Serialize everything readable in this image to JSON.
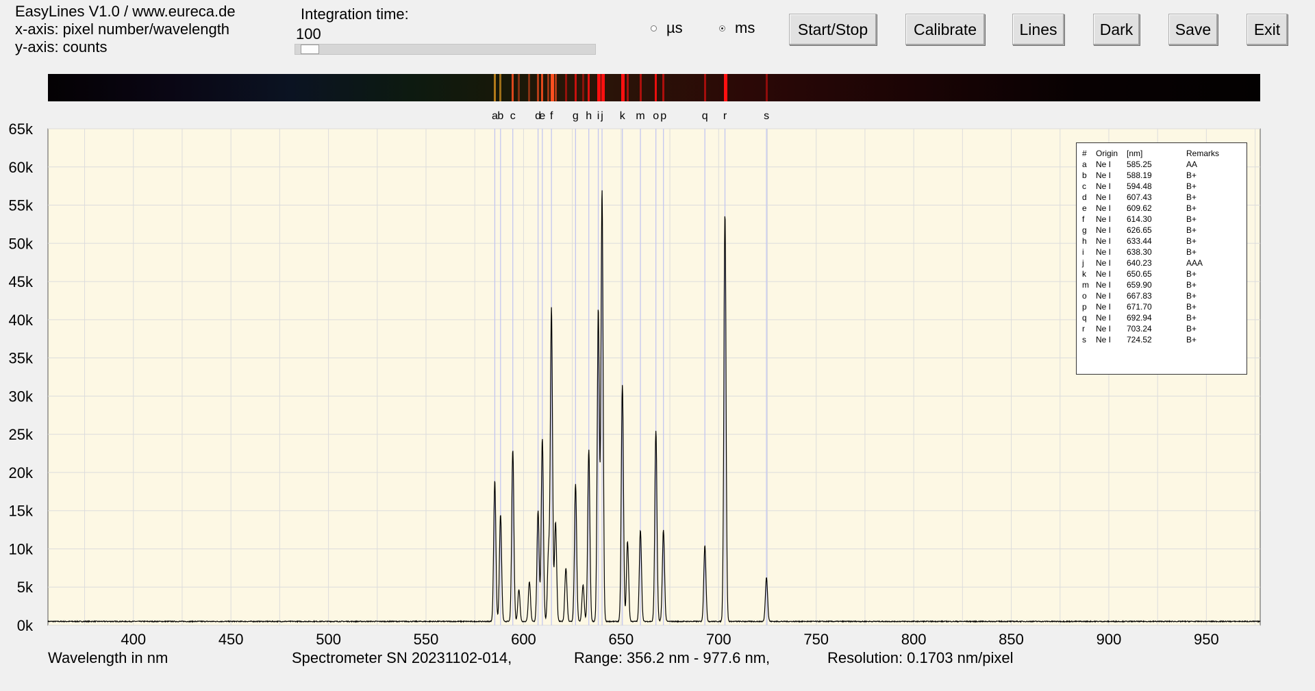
{
  "header": {
    "title": "EasyLines V1.0 / www.eureca.de",
    "xaxis_info": "x-axis: pixel number/wavelength",
    "yaxis_info": "y-axis: counts"
  },
  "integration": {
    "label": "Integration time:",
    "value": "100",
    "slider_fraction": 0.01
  },
  "units": {
    "us_label": "µs",
    "ms_label": "ms",
    "selected": "ms"
  },
  "buttons": {
    "start_stop": "Start/Stop",
    "calibrate": "Calibrate",
    "lines": "Lines",
    "dark": "Dark",
    "save": "Save",
    "exit": "Exit"
  },
  "footer": {
    "xlabel": "Wavelength in nm",
    "serial": "Spectrometer SN 20231102-014,",
    "range": "Range: 356.2 nm - 977.6 nm,",
    "resolution": "Resolution: 0.1703 nm/pixel"
  },
  "colors": {
    "plot_background": "#fdf8e4",
    "grid": "#dcdcdc",
    "line_marker": "#c3c6f0",
    "trace": "#000000"
  },
  "lines_table": {
    "headers": [
      "#",
      "Origin",
      "[nm]",
      "Remarks"
    ],
    "rows": [
      [
        "a",
        "Ne I",
        "585.25",
        "AA"
      ],
      [
        "b",
        "Ne I",
        "588.19",
        "B+"
      ],
      [
        "c",
        "Ne I",
        "594.48",
        "B+"
      ],
      [
        "d",
        "Ne I",
        "607.43",
        "B+"
      ],
      [
        "e",
        "Ne I",
        "609.62",
        "B+"
      ],
      [
        "f",
        "Ne I",
        "614.30",
        "B+"
      ],
      [
        "g",
        "Ne I",
        "626.65",
        "B+"
      ],
      [
        "h",
        "Ne I",
        "633.44",
        "B+"
      ],
      [
        "i",
        "Ne I",
        "638.30",
        "B+"
      ],
      [
        "j",
        "Ne I",
        "640.23",
        "AAA"
      ],
      [
        "k",
        "Ne I",
        "650.65",
        "B+"
      ],
      [
        "m",
        "Ne I",
        "659.90",
        "B+"
      ],
      [
        "o",
        "Ne I",
        "667.83",
        "B+"
      ],
      [
        "p",
        "Ne I",
        "671.70",
        "B+"
      ],
      [
        "q",
        "Ne I",
        "692.94",
        "B+"
      ],
      [
        "r",
        "Ne I",
        "703.24",
        "B+"
      ],
      [
        "s",
        "Ne I",
        "724.52",
        "B+"
      ]
    ]
  },
  "chart_data": {
    "type": "line",
    "xlabel": "Wavelength in nm",
    "ylabel": "",
    "xlim": [
      356.2,
      977.6
    ],
    "ylim": [
      0,
      65000
    ],
    "x_ticks": [
      400,
      450,
      500,
      550,
      600,
      650,
      700,
      750,
      800,
      850,
      900,
      950
    ],
    "x_tick_labels": [
      "400",
      "450",
      "500",
      "550",
      "600",
      "650",
      "700",
      "750",
      "800",
      "850",
      "900",
      "950"
    ],
    "y_ticks": [
      0,
      5000,
      10000,
      15000,
      20000,
      25000,
      30000,
      35000,
      40000,
      45000,
      50000,
      55000,
      60000,
      65000
    ],
    "y_tick_labels": [
      "0k",
      "5k",
      "10k",
      "15k",
      "20k",
      "25k",
      "30k",
      "35k",
      "40k",
      "45k",
      "50k",
      "55k",
      "60k",
      "65k"
    ],
    "grid": true,
    "baseline_counts": 500,
    "series": [
      {
        "peaks": [
          {
            "x": 585.25,
            "y": 18500
          },
          {
            "x": 588.19,
            "y": 14000
          },
          {
            "x": 594.48,
            "y": 22500
          },
          {
            "x": 597.6,
            "y": 4200
          },
          {
            "x": 603.0,
            "y": 5200
          },
          {
            "x": 607.43,
            "y": 14500
          },
          {
            "x": 609.62,
            "y": 24000
          },
          {
            "x": 612.8,
            "y": 9000
          },
          {
            "x": 614.3,
            "y": 41000
          },
          {
            "x": 616.4,
            "y": 13000
          },
          {
            "x": 621.7,
            "y": 7000
          },
          {
            "x": 626.65,
            "y": 18000
          },
          {
            "x": 630.5,
            "y": 4800
          },
          {
            "x": 633.44,
            "y": 22500
          },
          {
            "x": 638.3,
            "y": 41000
          },
          {
            "x": 640.23,
            "y": 56500
          },
          {
            "x": 650.65,
            "y": 31000
          },
          {
            "x": 653.3,
            "y": 10500
          },
          {
            "x": 659.9,
            "y": 12000
          },
          {
            "x": 667.83,
            "y": 25000
          },
          {
            "x": 671.7,
            "y": 12000
          },
          {
            "x": 692.94,
            "y": 10000
          },
          {
            "x": 703.24,
            "y": 53500
          },
          {
            "x": 724.52,
            "y": 5800
          }
        ]
      }
    ],
    "line_markers": [
      {
        "letter": "a",
        "x": 585.25
      },
      {
        "letter": "b",
        "x": 588.19
      },
      {
        "letter": "c",
        "x": 594.48
      },
      {
        "letter": "d",
        "x": 607.43
      },
      {
        "letter": "e",
        "x": 609.62
      },
      {
        "letter": "f",
        "x": 614.3
      },
      {
        "letter": "g",
        "x": 626.65
      },
      {
        "letter": "h",
        "x": 633.44
      },
      {
        "letter": "i",
        "x": 638.3
      },
      {
        "letter": "j",
        "x": 640.23
      },
      {
        "letter": "k",
        "x": 650.65
      },
      {
        "letter": "m",
        "x": 659.9
      },
      {
        "letter": "o",
        "x": 667.83
      },
      {
        "letter": "p",
        "x": 671.7
      },
      {
        "letter": "q",
        "x": 692.94
      },
      {
        "letter": "r",
        "x": 703.24
      },
      {
        "letter": "s",
        "x": 724.52
      }
    ]
  }
}
